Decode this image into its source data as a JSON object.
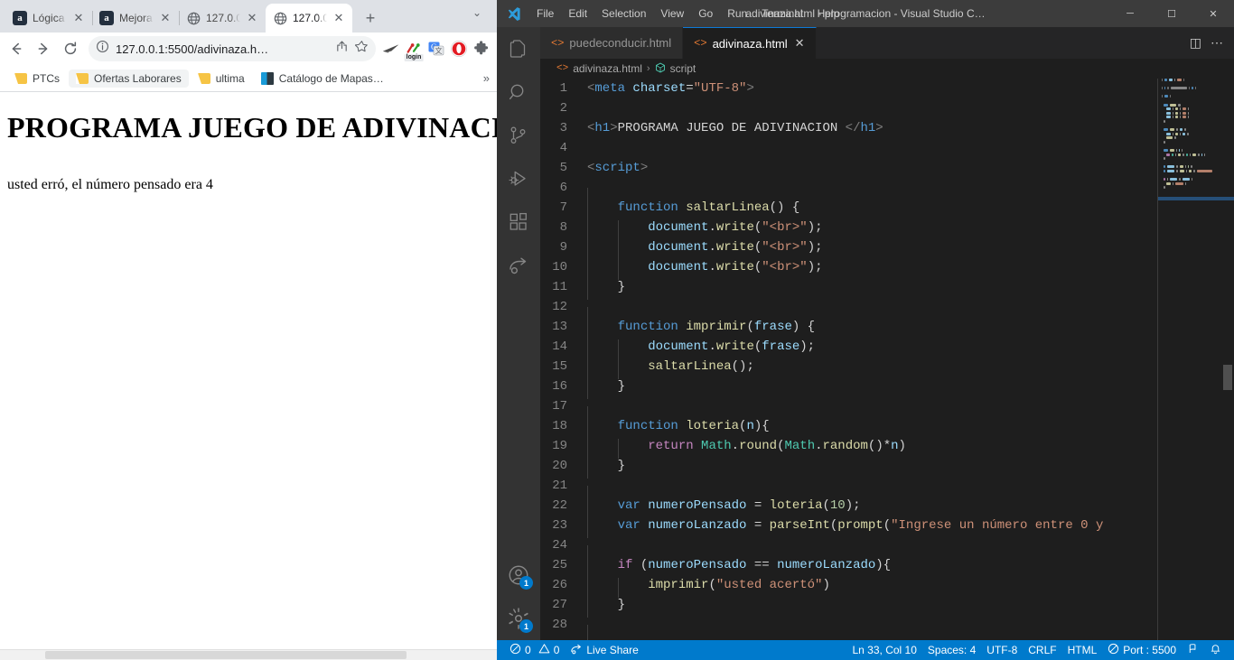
{
  "browser": {
    "tabs": [
      {
        "title": "Lógica",
        "favicon": "amazon-icon",
        "active": false
      },
      {
        "title": "Mejora",
        "favicon": "amazon-icon",
        "active": false
      },
      {
        "title": "127.0.0",
        "favicon": "globe-icon",
        "active": false
      },
      {
        "title": "127.0.0",
        "favicon": "globe-icon",
        "active": true
      }
    ],
    "new_tab_label": "+",
    "tab_list_chevron": "⌄",
    "toolbar": {
      "back_label": "←",
      "forward_label": "→",
      "reload_label": "↻",
      "site_info_label": "ⓘ",
      "url": "127.0.0.1:5500/adivinaza.h…",
      "share_label": "⤴",
      "bookmark_star_label": "☆",
      "extensions": [
        {
          "name": "dark-paper-plane-extension-icon",
          "label": ""
        },
        {
          "name": "login-pins-extension-icon",
          "label": "login"
        },
        {
          "name": "google-translate-extension-icon",
          "label": ""
        },
        {
          "name": "opera-extension-icon",
          "label": ""
        },
        {
          "name": "extensions-puzzle-icon",
          "label": ""
        }
      ]
    },
    "bookmarks": [
      {
        "label": "PTCs",
        "icon": "folder-icon"
      },
      {
        "label": "Ofertas Laborares",
        "icon": "folder-icon"
      },
      {
        "label": "ultima",
        "icon": "folder-icon"
      },
      {
        "label": "Catálogo de Mapas…",
        "icon": "tile-icon"
      }
    ],
    "bookmarks_overflow_label": "»",
    "page": {
      "heading": "PROGRAMA JUEGO DE ADIVINACION",
      "paragraph": "usted erró, el número pensado era 4"
    }
  },
  "vscode": {
    "window_title": "adivinaza.html - programacion - Visual Studio C…",
    "menu": [
      "File",
      "Edit",
      "Selection",
      "View",
      "Go",
      "Run",
      "Terminal",
      "Help"
    ],
    "window_controls": {
      "minimize": "─",
      "maximize": "☐",
      "close": "✕"
    },
    "activity_bar": [
      {
        "name": "explorer-icon",
        "active": false
      },
      {
        "name": "search-icon",
        "active": false
      },
      {
        "name": "source-control-icon",
        "active": false
      },
      {
        "name": "run-and-debug-icon",
        "active": false
      },
      {
        "name": "extensions-icon",
        "active": false
      },
      {
        "name": "live-share-icon",
        "active": false
      }
    ],
    "activity_bar_bottom": [
      {
        "name": "accounts-icon",
        "badge": "1"
      },
      {
        "name": "settings-gear-icon",
        "badge": "1"
      }
    ],
    "editor_tabs": [
      {
        "label": "puedeconducir.html",
        "active": false,
        "close_label": ""
      },
      {
        "label": "adivinaza.html",
        "active": true,
        "close_label": "✕"
      }
    ],
    "tabsbar_actions": {
      "split_editor_label": "◫",
      "more_actions_label": "⋯"
    },
    "breadcrumb": {
      "file": "adivinaza.html",
      "separator": "›",
      "symbol": "script"
    },
    "code_lines": [
      {
        "n": 1,
        "indent": 0,
        "tokens": [
          {
            "t": "<",
            "c": "c-punct"
          },
          {
            "t": "meta",
            "c": "c-tagname"
          },
          {
            "t": " ",
            "c": "c-plain"
          },
          {
            "t": "charset",
            "c": "c-attr"
          },
          {
            "t": "=",
            "c": "c-plain"
          },
          {
            "t": "\"UTF-8\"",
            "c": "c-str"
          },
          {
            "t": ">",
            "c": "c-punct"
          }
        ]
      },
      {
        "n": 2,
        "indent": 0,
        "tokens": []
      },
      {
        "n": 3,
        "indent": 0,
        "tokens": [
          {
            "t": "<",
            "c": "c-punct"
          },
          {
            "t": "h1",
            "c": "c-tagname"
          },
          {
            "t": ">",
            "c": "c-punct"
          },
          {
            "t": "PROGRAMA JUEGO DE ADIVINACION ",
            "c": "c-plain"
          },
          {
            "t": "</",
            "c": "c-punct"
          },
          {
            "t": "h1",
            "c": "c-tagname"
          },
          {
            "t": ">",
            "c": "c-punct"
          }
        ]
      },
      {
        "n": 4,
        "indent": 0,
        "tokens": []
      },
      {
        "n": 5,
        "indent": 0,
        "tokens": [
          {
            "t": "<",
            "c": "c-punct"
          },
          {
            "t": "script",
            "c": "c-tagname"
          },
          {
            "t": ">",
            "c": "c-punct"
          }
        ]
      },
      {
        "n": 6,
        "indent": 1,
        "tokens": []
      },
      {
        "n": 7,
        "indent": 1,
        "tokens": [
          {
            "t": "    ",
            "c": "c-plain"
          },
          {
            "t": "function",
            "c": "c-kw"
          },
          {
            "t": " ",
            "c": "c-plain"
          },
          {
            "t": "saltarLinea",
            "c": "c-fn"
          },
          {
            "t": "() {",
            "c": "c-plain"
          }
        ]
      },
      {
        "n": 8,
        "indent": 2,
        "tokens": [
          {
            "t": "        ",
            "c": "c-plain"
          },
          {
            "t": "document",
            "c": "c-var"
          },
          {
            "t": ".",
            "c": "c-plain"
          },
          {
            "t": "write",
            "c": "c-fn"
          },
          {
            "t": "(",
            "c": "c-plain"
          },
          {
            "t": "\"<br>\"",
            "c": "c-str"
          },
          {
            "t": ");",
            "c": "c-plain"
          }
        ]
      },
      {
        "n": 9,
        "indent": 2,
        "tokens": [
          {
            "t": "        ",
            "c": "c-plain"
          },
          {
            "t": "document",
            "c": "c-var"
          },
          {
            "t": ".",
            "c": "c-plain"
          },
          {
            "t": "write",
            "c": "c-fn"
          },
          {
            "t": "(",
            "c": "c-plain"
          },
          {
            "t": "\"<br>\"",
            "c": "c-str"
          },
          {
            "t": ");",
            "c": "c-plain"
          }
        ]
      },
      {
        "n": 10,
        "indent": 2,
        "tokens": [
          {
            "t": "        ",
            "c": "c-plain"
          },
          {
            "t": "document",
            "c": "c-var"
          },
          {
            "t": ".",
            "c": "c-plain"
          },
          {
            "t": "write",
            "c": "c-fn"
          },
          {
            "t": "(",
            "c": "c-plain"
          },
          {
            "t": "\"<br>\"",
            "c": "c-str"
          },
          {
            "t": ");",
            "c": "c-plain"
          }
        ]
      },
      {
        "n": 11,
        "indent": 1,
        "tokens": [
          {
            "t": "    }",
            "c": "c-plain"
          }
        ]
      },
      {
        "n": 12,
        "indent": 1,
        "tokens": []
      },
      {
        "n": 13,
        "indent": 1,
        "tokens": [
          {
            "t": "    ",
            "c": "c-plain"
          },
          {
            "t": "function",
            "c": "c-kw"
          },
          {
            "t": " ",
            "c": "c-plain"
          },
          {
            "t": "imprimir",
            "c": "c-fn"
          },
          {
            "t": "(",
            "c": "c-plain"
          },
          {
            "t": "frase",
            "c": "c-var"
          },
          {
            "t": ") {",
            "c": "c-plain"
          }
        ]
      },
      {
        "n": 14,
        "indent": 2,
        "tokens": [
          {
            "t": "        ",
            "c": "c-plain"
          },
          {
            "t": "document",
            "c": "c-var"
          },
          {
            "t": ".",
            "c": "c-plain"
          },
          {
            "t": "write",
            "c": "c-fn"
          },
          {
            "t": "(",
            "c": "c-plain"
          },
          {
            "t": "frase",
            "c": "c-var"
          },
          {
            "t": ");",
            "c": "c-plain"
          }
        ]
      },
      {
        "n": 15,
        "indent": 2,
        "tokens": [
          {
            "t": "        ",
            "c": "c-plain"
          },
          {
            "t": "saltarLinea",
            "c": "c-fn"
          },
          {
            "t": "();",
            "c": "c-plain"
          }
        ]
      },
      {
        "n": 16,
        "indent": 1,
        "tokens": [
          {
            "t": "    }",
            "c": "c-plain"
          }
        ]
      },
      {
        "n": 17,
        "indent": 1,
        "tokens": []
      },
      {
        "n": 18,
        "indent": 1,
        "tokens": [
          {
            "t": "    ",
            "c": "c-plain"
          },
          {
            "t": "function",
            "c": "c-kw"
          },
          {
            "t": " ",
            "c": "c-plain"
          },
          {
            "t": "loteria",
            "c": "c-fn"
          },
          {
            "t": "(",
            "c": "c-plain"
          },
          {
            "t": "n",
            "c": "c-var"
          },
          {
            "t": "){",
            "c": "c-plain"
          }
        ]
      },
      {
        "n": 19,
        "indent": 2,
        "tokens": [
          {
            "t": "        ",
            "c": "c-plain"
          },
          {
            "t": "return",
            "c": "c-kwctl"
          },
          {
            "t": " ",
            "c": "c-plain"
          },
          {
            "t": "Math",
            "c": "c-cls"
          },
          {
            "t": ".",
            "c": "c-plain"
          },
          {
            "t": "round",
            "c": "c-fn"
          },
          {
            "t": "(",
            "c": "c-plain"
          },
          {
            "t": "Math",
            "c": "c-cls"
          },
          {
            "t": ".",
            "c": "c-plain"
          },
          {
            "t": "random",
            "c": "c-fn"
          },
          {
            "t": "()*",
            "c": "c-plain"
          },
          {
            "t": "n",
            "c": "c-var"
          },
          {
            "t": ")",
            "c": "c-plain"
          }
        ]
      },
      {
        "n": 20,
        "indent": 1,
        "tokens": [
          {
            "t": "    }",
            "c": "c-plain"
          }
        ]
      },
      {
        "n": 21,
        "indent": 1,
        "tokens": []
      },
      {
        "n": 22,
        "indent": 1,
        "tokens": [
          {
            "t": "    ",
            "c": "c-plain"
          },
          {
            "t": "var",
            "c": "c-kw"
          },
          {
            "t": " ",
            "c": "c-plain"
          },
          {
            "t": "numeroPensado",
            "c": "c-var"
          },
          {
            "t": " = ",
            "c": "c-plain"
          },
          {
            "t": "loteria",
            "c": "c-fn"
          },
          {
            "t": "(",
            "c": "c-plain"
          },
          {
            "t": "10",
            "c": "c-num"
          },
          {
            "t": ");",
            "c": "c-plain"
          }
        ]
      },
      {
        "n": 23,
        "indent": 1,
        "tokens": [
          {
            "t": "    ",
            "c": "c-plain"
          },
          {
            "t": "var",
            "c": "c-kw"
          },
          {
            "t": " ",
            "c": "c-plain"
          },
          {
            "t": "numeroLanzado",
            "c": "c-var"
          },
          {
            "t": " = ",
            "c": "c-plain"
          },
          {
            "t": "parseInt",
            "c": "c-fn"
          },
          {
            "t": "(",
            "c": "c-plain"
          },
          {
            "t": "prompt",
            "c": "c-fn"
          },
          {
            "t": "(",
            "c": "c-plain"
          },
          {
            "t": "\"Ingrese un número entre 0 y",
            "c": "c-str"
          }
        ]
      },
      {
        "n": 24,
        "indent": 1,
        "tokens": []
      },
      {
        "n": 25,
        "indent": 1,
        "tokens": [
          {
            "t": "    ",
            "c": "c-plain"
          },
          {
            "t": "if",
            "c": "c-kwctl"
          },
          {
            "t": " (",
            "c": "c-plain"
          },
          {
            "t": "numeroPensado",
            "c": "c-var"
          },
          {
            "t": " == ",
            "c": "c-plain"
          },
          {
            "t": "numeroLanzado",
            "c": "c-var"
          },
          {
            "t": "){",
            "c": "c-plain"
          }
        ]
      },
      {
        "n": 26,
        "indent": 2,
        "tokens": [
          {
            "t": "        ",
            "c": "c-plain"
          },
          {
            "t": "imprimir",
            "c": "c-fn"
          },
          {
            "t": "(",
            "c": "c-plain"
          },
          {
            "t": "\"usted acertó\"",
            "c": "c-str"
          },
          {
            "t": ")",
            "c": "c-plain"
          }
        ]
      },
      {
        "n": 27,
        "indent": 1,
        "tokens": [
          {
            "t": "    }",
            "c": "c-plain"
          }
        ]
      },
      {
        "n": 28,
        "indent": 1,
        "tokens": []
      }
    ],
    "statusbar": {
      "errors_icon": "error-circle-icon",
      "errors": "0",
      "warnings_icon": "warning-triangle-icon",
      "warnings": "0",
      "live_share_icon": "live-share-icon",
      "live_share": "Live Share",
      "cursor_position": "Ln 33, Col 10",
      "indentation": "Spaces: 4",
      "encoding": "UTF-8",
      "eol": "CRLF",
      "language": "HTML",
      "port_icon": "radio-tower-icon",
      "port": "Port : 5500",
      "feedback_icon": "feedback-smiley-icon",
      "notifications_icon": "bell-icon"
    }
  },
  "colors": {
    "browser_tabstrip": "#dee1e6",
    "vscode_titlebar": "#3c3c3c",
    "vscode_activitybar": "#333333",
    "vscode_editor_bg": "#1e1e1e",
    "vscode_statusbar": "#007acc",
    "accent_blue": "#007acc",
    "html_tag_orange": "#e37933",
    "badge_blue": "#007acc"
  }
}
